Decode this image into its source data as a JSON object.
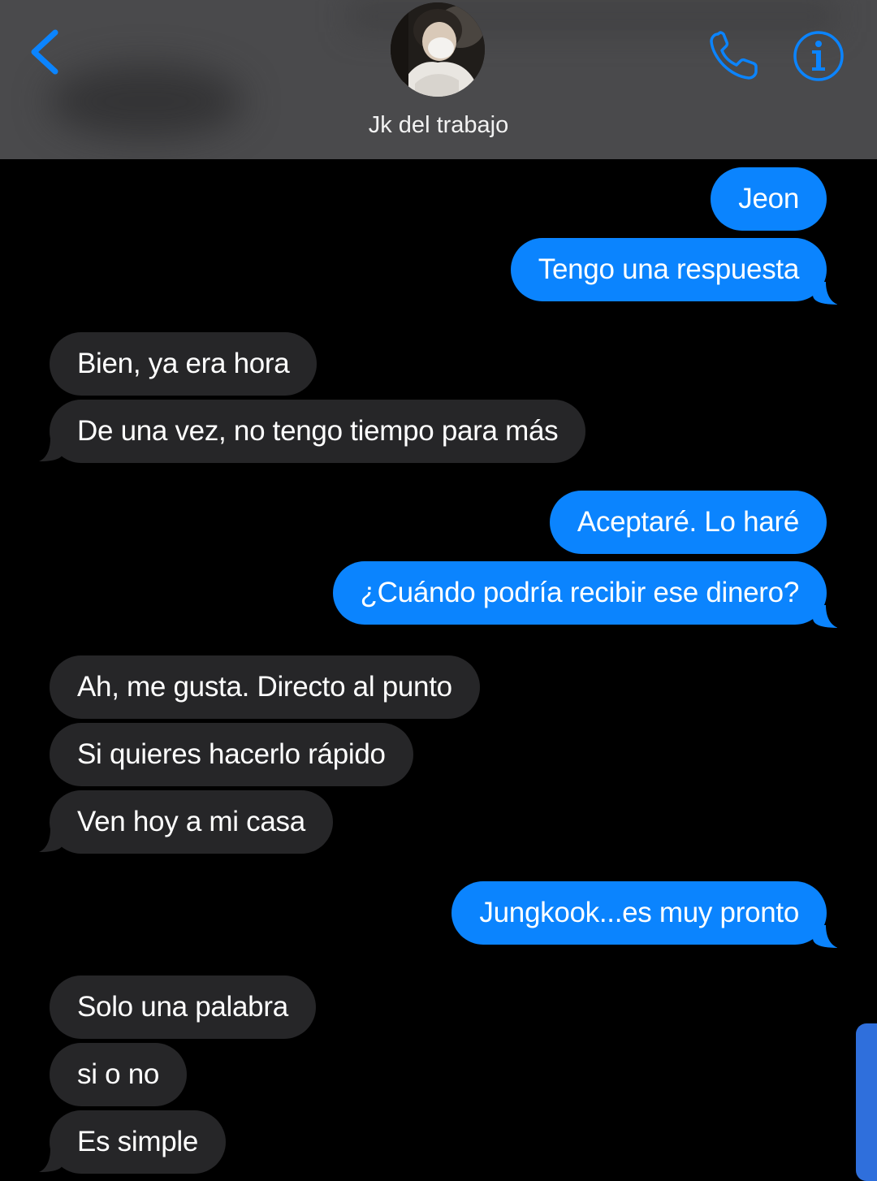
{
  "header": {
    "contact_name": "Jk del trabajo",
    "back_icon": "chevron-left-icon",
    "call_icon": "phone-icon",
    "info_icon": "info-icon",
    "accent_color": "#0b84fe"
  },
  "messages": [
    {
      "direction": "outgoing",
      "text": "Jeon"
    },
    {
      "direction": "outgoing",
      "text": "Tengo una respuesta"
    },
    {
      "direction": "incoming",
      "text": "Bien, ya era hora"
    },
    {
      "direction": "incoming",
      "text": "De una vez, no tengo tiempo para más"
    },
    {
      "direction": "outgoing",
      "text": "Aceptaré. Lo haré"
    },
    {
      "direction": "outgoing",
      "text": "¿Cuándo podría recibir ese dinero?"
    },
    {
      "direction": "incoming",
      "text": "Ah, me gusta. Directo al punto"
    },
    {
      "direction": "incoming",
      "text": "Si quieres hacerlo rápido"
    },
    {
      "direction": "incoming",
      "text": "Ven hoy a mi casa"
    },
    {
      "direction": "outgoing",
      "text": "Jungkook...es muy pronto"
    },
    {
      "direction": "incoming",
      "text": "Solo una palabra"
    },
    {
      "direction": "incoming",
      "text": "si o no"
    },
    {
      "direction": "incoming",
      "text": "Es simple"
    }
  ],
  "colors": {
    "outgoing_bubble": "#0b84fe",
    "incoming_bubble": "#262628",
    "header_background": "#4a4a4c",
    "background": "#000000"
  }
}
